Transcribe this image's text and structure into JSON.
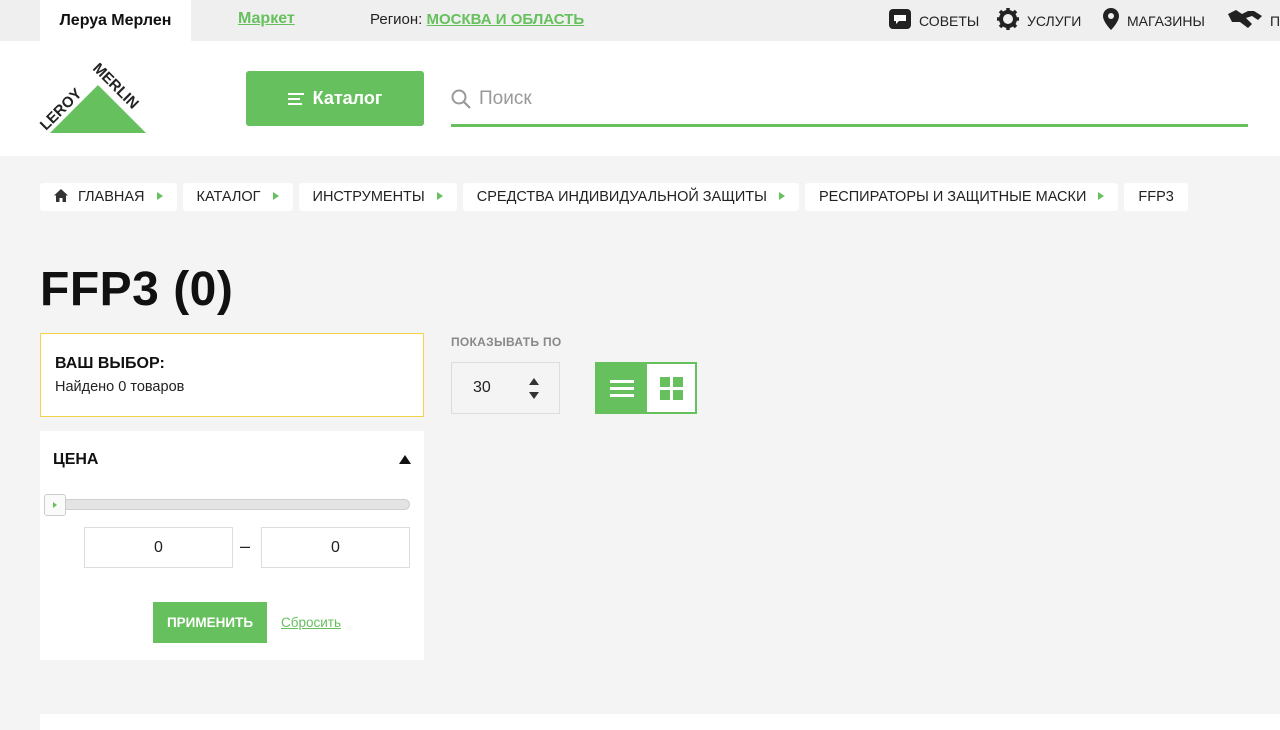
{
  "topbar": {
    "active_tab": "Леруа Мерлен",
    "market_tab": "Маркет",
    "region_label": "Регион:",
    "region_value": "МОСКВА И ОБЛАСТЬ",
    "nav": {
      "advice": "СОВЕТЫ",
      "services": "УСЛУГИ",
      "stores": "МАГАЗИНЫ",
      "partners": "П"
    }
  },
  "header": {
    "logo_text": "LEROY MERLIN",
    "catalog_label": "Каталог",
    "search_placeholder": "Поиск"
  },
  "breadcrumbs": [
    {
      "label": "ГЛАВНАЯ"
    },
    {
      "label": "КАТАЛОГ"
    },
    {
      "label": "ИНСТРУМЕНТЫ"
    },
    {
      "label": "СРЕДСТВА ИНДИВИДУАЛЬНОЙ ЗАЩИТЫ"
    },
    {
      "label": "РЕСПИРАТОРЫ И ЗАЩИТНЫЕ МАСКИ"
    },
    {
      "label": "FFP3"
    }
  ],
  "page_title": "FFP3 (0)",
  "selection": {
    "title": "ВАШ ВЫБОР:",
    "found": "Найдено 0 товаров"
  },
  "price_filter": {
    "title": "ЦЕНА",
    "min_value": "0",
    "max_value": "0",
    "dash": "–",
    "apply_label": "ПРИМЕНИТЬ",
    "reset_label": "Сбросить"
  },
  "per_page": {
    "label": "ПОКАЗЫВАТЬ ПО",
    "value": "30"
  },
  "colors": {
    "accent": "#66c05d",
    "selection_border": "#f2d44a"
  }
}
